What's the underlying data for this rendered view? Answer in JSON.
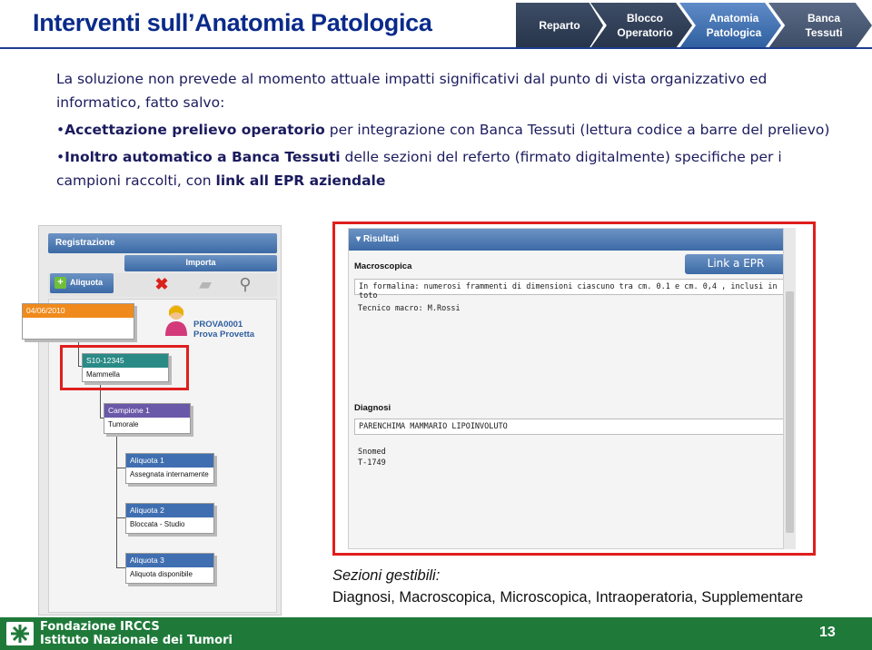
{
  "header": {
    "title": "Interventi sull’Anatomia Patologica",
    "breadcrumbs": [
      {
        "label": "Reparto",
        "state": "dark"
      },
      {
        "label": "Blocco\nOperatorio",
        "state": "dark"
      },
      {
        "label": "Anatomia\nPatologica",
        "state": "active"
      },
      {
        "label": "Banca\nTessuti",
        "state": "light"
      }
    ]
  },
  "body": {
    "intro": "La soluzione non prevede al momento attuale impatti significativi dal punto di vista organizzativo ed informatico, fatto salvo:",
    "bullet1_bold": "Accettazione prelievo operatorio",
    "bullet1_rest": " per integrazione con Banca Tessuti (lettura codice a barre del prelievo)",
    "bullet2_bold": "Inoltro automatico a Banca Tessuti",
    "bullet2_mid": " delle sezioni del referto (firmato digitalmente) specifiche per i campioni raccolti, con ",
    "bullet2_bold2": "link all EPR aziendale"
  },
  "left_panel": {
    "header": "Registrazione",
    "import_label": "Importa",
    "aliquota_button": "Aliquota",
    "patient_id": "PROVA0001",
    "patient_name": "Prova Provetta",
    "date_card": "04/06/2010",
    "cards": [
      {
        "title": "S10-12345",
        "sub": "Mammella"
      },
      {
        "title": "Campione 1",
        "sub": "Tumorale"
      },
      {
        "title": "Aliquota 1",
        "sub": "Assegnata internamente"
      },
      {
        "title": "Aliquota 2",
        "sub": "Bloccata - Studio"
      },
      {
        "title": "Aliquota 3",
        "sub": "Aliquota disponibile"
      }
    ]
  },
  "right_panel": {
    "header": "Risultati",
    "epr_button": "Link a EPR",
    "macro_label": "Macroscopica",
    "macro_text": "In formalina: numerosi frammenti di dimensioni ciascuno tra cm. 0.1 e cm. 0,4 , inclusi in toto",
    "macro_tech": "Tecnico macro: M.Rossi",
    "diag_label": "Diagnosi",
    "diag_text": "PARENCHIMA MAMMARIO LIPOINVOLUTO",
    "snomed_label": "Snomed",
    "snomed_code": "T-1749"
  },
  "caption": {
    "line1": "Sezioni gestibili:",
    "line2": "Diagnosi, Macroscopica, Microscopica, Intraoperatoria, Supplementare"
  },
  "footer": {
    "line1": "Fondazione IRCCS",
    "line2": "Istituto Nazionale dei Tumori",
    "page": "13"
  },
  "colors": {
    "title": "#0a2a8a",
    "highlight": "#e01e1e",
    "footer": "#1f7a3a"
  }
}
